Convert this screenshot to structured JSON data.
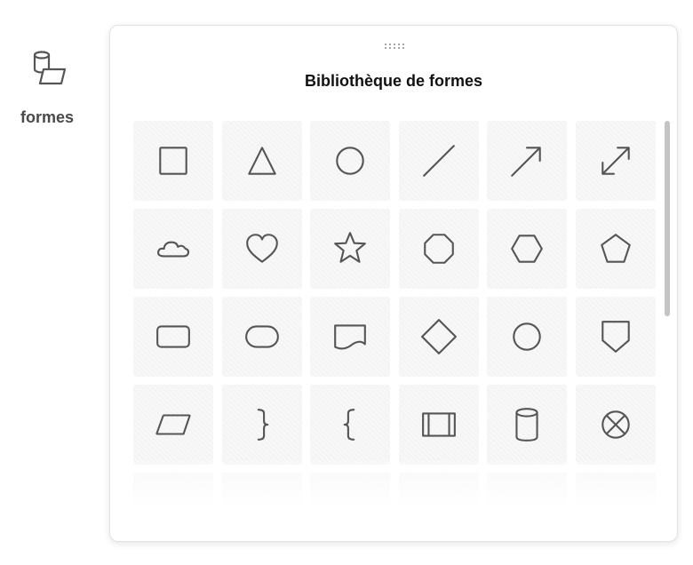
{
  "sidebar": {
    "shapes_button": {
      "label": "formes",
      "icon": "shapes-icon"
    }
  },
  "panel": {
    "title": "Bibliothèque de formes",
    "handle_icon": "drag-handle-icon",
    "shapes": [
      {
        "name": "square",
        "icon": "square-icon"
      },
      {
        "name": "triangle",
        "icon": "triangle-icon"
      },
      {
        "name": "circle",
        "icon": "circle-icon"
      },
      {
        "name": "line",
        "icon": "line-icon"
      },
      {
        "name": "arrow",
        "icon": "arrow-icon"
      },
      {
        "name": "double-arrow",
        "icon": "double-arrow-icon"
      },
      {
        "name": "cloud",
        "icon": "cloud-icon"
      },
      {
        "name": "heart",
        "icon": "heart-icon"
      },
      {
        "name": "star",
        "icon": "star-icon"
      },
      {
        "name": "octagon",
        "icon": "octagon-icon"
      },
      {
        "name": "hexagon",
        "icon": "hexagon-icon"
      },
      {
        "name": "pentagon",
        "icon": "pentagon-icon"
      },
      {
        "name": "rounded-rectangle",
        "icon": "rounded-rectangle-icon"
      },
      {
        "name": "pill",
        "icon": "pill-icon"
      },
      {
        "name": "document",
        "icon": "document-icon"
      },
      {
        "name": "diamond",
        "icon": "diamond-icon"
      },
      {
        "name": "ellipse",
        "icon": "ellipse-icon"
      },
      {
        "name": "offpage-connector",
        "icon": "offpage-connector-icon"
      },
      {
        "name": "parallelogram",
        "icon": "parallelogram-icon"
      },
      {
        "name": "right-brace",
        "icon": "right-brace-icon"
      },
      {
        "name": "left-brace",
        "icon": "left-brace-icon"
      },
      {
        "name": "predefined-process",
        "icon": "predefined-process-icon"
      },
      {
        "name": "cylinder",
        "icon": "cylinder-icon"
      },
      {
        "name": "cross-circle",
        "icon": "cross-circle-icon"
      },
      {
        "name": "partial-shape-1",
        "icon": "partial-shape-icon"
      },
      {
        "name": "partial-shape-2",
        "icon": "partial-shape-icon"
      },
      {
        "name": "partial-shape-3",
        "icon": "partial-shape-icon"
      },
      {
        "name": "partial-shape-4",
        "icon": "partial-shape-icon"
      },
      {
        "name": "partial-shape-5",
        "icon": "partial-shape-icon"
      },
      {
        "name": "partial-shape-6",
        "icon": "partial-shape-icon"
      }
    ]
  },
  "colors": {
    "icon_stroke": "#555555",
    "tile_background": "#f7f7f7",
    "scrollbar_thumb": "#c4c4c4"
  }
}
